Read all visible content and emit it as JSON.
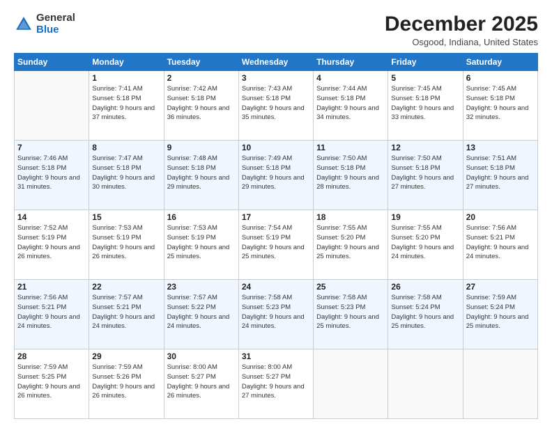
{
  "logo": {
    "general": "General",
    "blue": "Blue"
  },
  "header": {
    "month": "December 2025",
    "location": "Osgood, Indiana, United States"
  },
  "weekdays": [
    "Sunday",
    "Monday",
    "Tuesday",
    "Wednesday",
    "Thursday",
    "Friday",
    "Saturday"
  ],
  "weeks": [
    [
      {
        "day": "",
        "sunrise": "",
        "sunset": "",
        "daylight": ""
      },
      {
        "day": "1",
        "sunrise": "Sunrise: 7:41 AM",
        "sunset": "Sunset: 5:18 PM",
        "daylight": "Daylight: 9 hours and 37 minutes."
      },
      {
        "day": "2",
        "sunrise": "Sunrise: 7:42 AM",
        "sunset": "Sunset: 5:18 PM",
        "daylight": "Daylight: 9 hours and 36 minutes."
      },
      {
        "day": "3",
        "sunrise": "Sunrise: 7:43 AM",
        "sunset": "Sunset: 5:18 PM",
        "daylight": "Daylight: 9 hours and 35 minutes."
      },
      {
        "day": "4",
        "sunrise": "Sunrise: 7:44 AM",
        "sunset": "Sunset: 5:18 PM",
        "daylight": "Daylight: 9 hours and 34 minutes."
      },
      {
        "day": "5",
        "sunrise": "Sunrise: 7:45 AM",
        "sunset": "Sunset: 5:18 PM",
        "daylight": "Daylight: 9 hours and 33 minutes."
      },
      {
        "day": "6",
        "sunrise": "Sunrise: 7:45 AM",
        "sunset": "Sunset: 5:18 PM",
        "daylight": "Daylight: 9 hours and 32 minutes."
      }
    ],
    [
      {
        "day": "7",
        "sunrise": "Sunrise: 7:46 AM",
        "sunset": "Sunset: 5:18 PM",
        "daylight": "Daylight: 9 hours and 31 minutes."
      },
      {
        "day": "8",
        "sunrise": "Sunrise: 7:47 AM",
        "sunset": "Sunset: 5:18 PM",
        "daylight": "Daylight: 9 hours and 30 minutes."
      },
      {
        "day": "9",
        "sunrise": "Sunrise: 7:48 AM",
        "sunset": "Sunset: 5:18 PM",
        "daylight": "Daylight: 9 hours and 29 minutes."
      },
      {
        "day": "10",
        "sunrise": "Sunrise: 7:49 AM",
        "sunset": "Sunset: 5:18 PM",
        "daylight": "Daylight: 9 hours and 29 minutes."
      },
      {
        "day": "11",
        "sunrise": "Sunrise: 7:50 AM",
        "sunset": "Sunset: 5:18 PM",
        "daylight": "Daylight: 9 hours and 28 minutes."
      },
      {
        "day": "12",
        "sunrise": "Sunrise: 7:50 AM",
        "sunset": "Sunset: 5:18 PM",
        "daylight": "Daylight: 9 hours and 27 minutes."
      },
      {
        "day": "13",
        "sunrise": "Sunrise: 7:51 AM",
        "sunset": "Sunset: 5:18 PM",
        "daylight": "Daylight: 9 hours and 27 minutes."
      }
    ],
    [
      {
        "day": "14",
        "sunrise": "Sunrise: 7:52 AM",
        "sunset": "Sunset: 5:19 PM",
        "daylight": "Daylight: 9 hours and 26 minutes."
      },
      {
        "day": "15",
        "sunrise": "Sunrise: 7:53 AM",
        "sunset": "Sunset: 5:19 PM",
        "daylight": "Daylight: 9 hours and 26 minutes."
      },
      {
        "day": "16",
        "sunrise": "Sunrise: 7:53 AM",
        "sunset": "Sunset: 5:19 PM",
        "daylight": "Daylight: 9 hours and 25 minutes."
      },
      {
        "day": "17",
        "sunrise": "Sunrise: 7:54 AM",
        "sunset": "Sunset: 5:19 PM",
        "daylight": "Daylight: 9 hours and 25 minutes."
      },
      {
        "day": "18",
        "sunrise": "Sunrise: 7:55 AM",
        "sunset": "Sunset: 5:20 PM",
        "daylight": "Daylight: 9 hours and 25 minutes."
      },
      {
        "day": "19",
        "sunrise": "Sunrise: 7:55 AM",
        "sunset": "Sunset: 5:20 PM",
        "daylight": "Daylight: 9 hours and 24 minutes."
      },
      {
        "day": "20",
        "sunrise": "Sunrise: 7:56 AM",
        "sunset": "Sunset: 5:21 PM",
        "daylight": "Daylight: 9 hours and 24 minutes."
      }
    ],
    [
      {
        "day": "21",
        "sunrise": "Sunrise: 7:56 AM",
        "sunset": "Sunset: 5:21 PM",
        "daylight": "Daylight: 9 hours and 24 minutes."
      },
      {
        "day": "22",
        "sunrise": "Sunrise: 7:57 AM",
        "sunset": "Sunset: 5:21 PM",
        "daylight": "Daylight: 9 hours and 24 minutes."
      },
      {
        "day": "23",
        "sunrise": "Sunrise: 7:57 AM",
        "sunset": "Sunset: 5:22 PM",
        "daylight": "Daylight: 9 hours and 24 minutes."
      },
      {
        "day": "24",
        "sunrise": "Sunrise: 7:58 AM",
        "sunset": "Sunset: 5:23 PM",
        "daylight": "Daylight: 9 hours and 24 minutes."
      },
      {
        "day": "25",
        "sunrise": "Sunrise: 7:58 AM",
        "sunset": "Sunset: 5:23 PM",
        "daylight": "Daylight: 9 hours and 25 minutes."
      },
      {
        "day": "26",
        "sunrise": "Sunrise: 7:58 AM",
        "sunset": "Sunset: 5:24 PM",
        "daylight": "Daylight: 9 hours and 25 minutes."
      },
      {
        "day": "27",
        "sunrise": "Sunrise: 7:59 AM",
        "sunset": "Sunset: 5:24 PM",
        "daylight": "Daylight: 9 hours and 25 minutes."
      }
    ],
    [
      {
        "day": "28",
        "sunrise": "Sunrise: 7:59 AM",
        "sunset": "Sunset: 5:25 PM",
        "daylight": "Daylight: 9 hours and 26 minutes."
      },
      {
        "day": "29",
        "sunrise": "Sunrise: 7:59 AM",
        "sunset": "Sunset: 5:26 PM",
        "daylight": "Daylight: 9 hours and 26 minutes."
      },
      {
        "day": "30",
        "sunrise": "Sunrise: 8:00 AM",
        "sunset": "Sunset: 5:27 PM",
        "daylight": "Daylight: 9 hours and 26 minutes."
      },
      {
        "day": "31",
        "sunrise": "Sunrise: 8:00 AM",
        "sunset": "Sunset: 5:27 PM",
        "daylight": "Daylight: 9 hours and 27 minutes."
      },
      {
        "day": "",
        "sunrise": "",
        "sunset": "",
        "daylight": ""
      },
      {
        "day": "",
        "sunrise": "",
        "sunset": "",
        "daylight": ""
      },
      {
        "day": "",
        "sunrise": "",
        "sunset": "",
        "daylight": ""
      }
    ]
  ]
}
